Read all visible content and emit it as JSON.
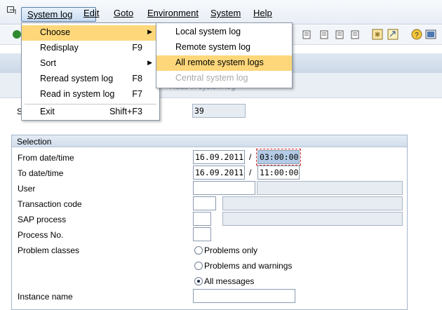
{
  "menubar": {
    "items": [
      {
        "label": "System log",
        "active": true
      },
      {
        "label": "Edit"
      },
      {
        "label": "Goto"
      },
      {
        "label": "Environment"
      },
      {
        "label": "System"
      },
      {
        "label": "Help"
      }
    ]
  },
  "dropdown": {
    "items": [
      {
        "label": "Choose",
        "shortcut": "",
        "submenu": true,
        "highlighted": true
      },
      {
        "label": "Redisplay",
        "shortcut": "F9"
      },
      {
        "label": "Sort",
        "shortcut": "",
        "submenu": true
      },
      {
        "label": "Reread system log",
        "shortcut": "F8"
      },
      {
        "label": "Read in system log",
        "shortcut": "F7"
      },
      {
        "label": "Exit",
        "shortcut": "Shift+F3"
      }
    ]
  },
  "submenu": {
    "items": [
      {
        "label": "Local system log"
      },
      {
        "label": "Remote system log"
      },
      {
        "label": "All remote system logs",
        "highlighted": true
      },
      {
        "label": "Central system log",
        "disabled": true
      }
    ]
  },
  "header": {
    "ghost_text": "Read in system log",
    "partial_label": "S",
    "count_value": "39"
  },
  "selection": {
    "title": "Selection",
    "from_label": "From date/time",
    "from_date": "16.09.2011",
    "from_time": "03:00:00",
    "to_label": "To date/time",
    "to_date": "16.09.2011",
    "to_time": "11:00:00",
    "separator": "/",
    "user_label": "User",
    "user_value": "",
    "tcode_label": "Transaction code",
    "tcode_value": "",
    "sap_process_label": "SAP process",
    "sap_process_value": "",
    "process_no_label": "Process No.",
    "process_no_value": "",
    "problem_classes_label": "Problem classes",
    "radio_problems_only": "Problems only",
    "radio_problems_warnings": "Problems and warnings",
    "radio_all_messages": "All messages",
    "selected_radio": "All messages",
    "instance_label": "Instance name",
    "instance_value": ""
  },
  "colors": {
    "highlight": "#fdd77a",
    "menubar_bg": "#eef3f9",
    "group_border": "#a6b6cb"
  }
}
